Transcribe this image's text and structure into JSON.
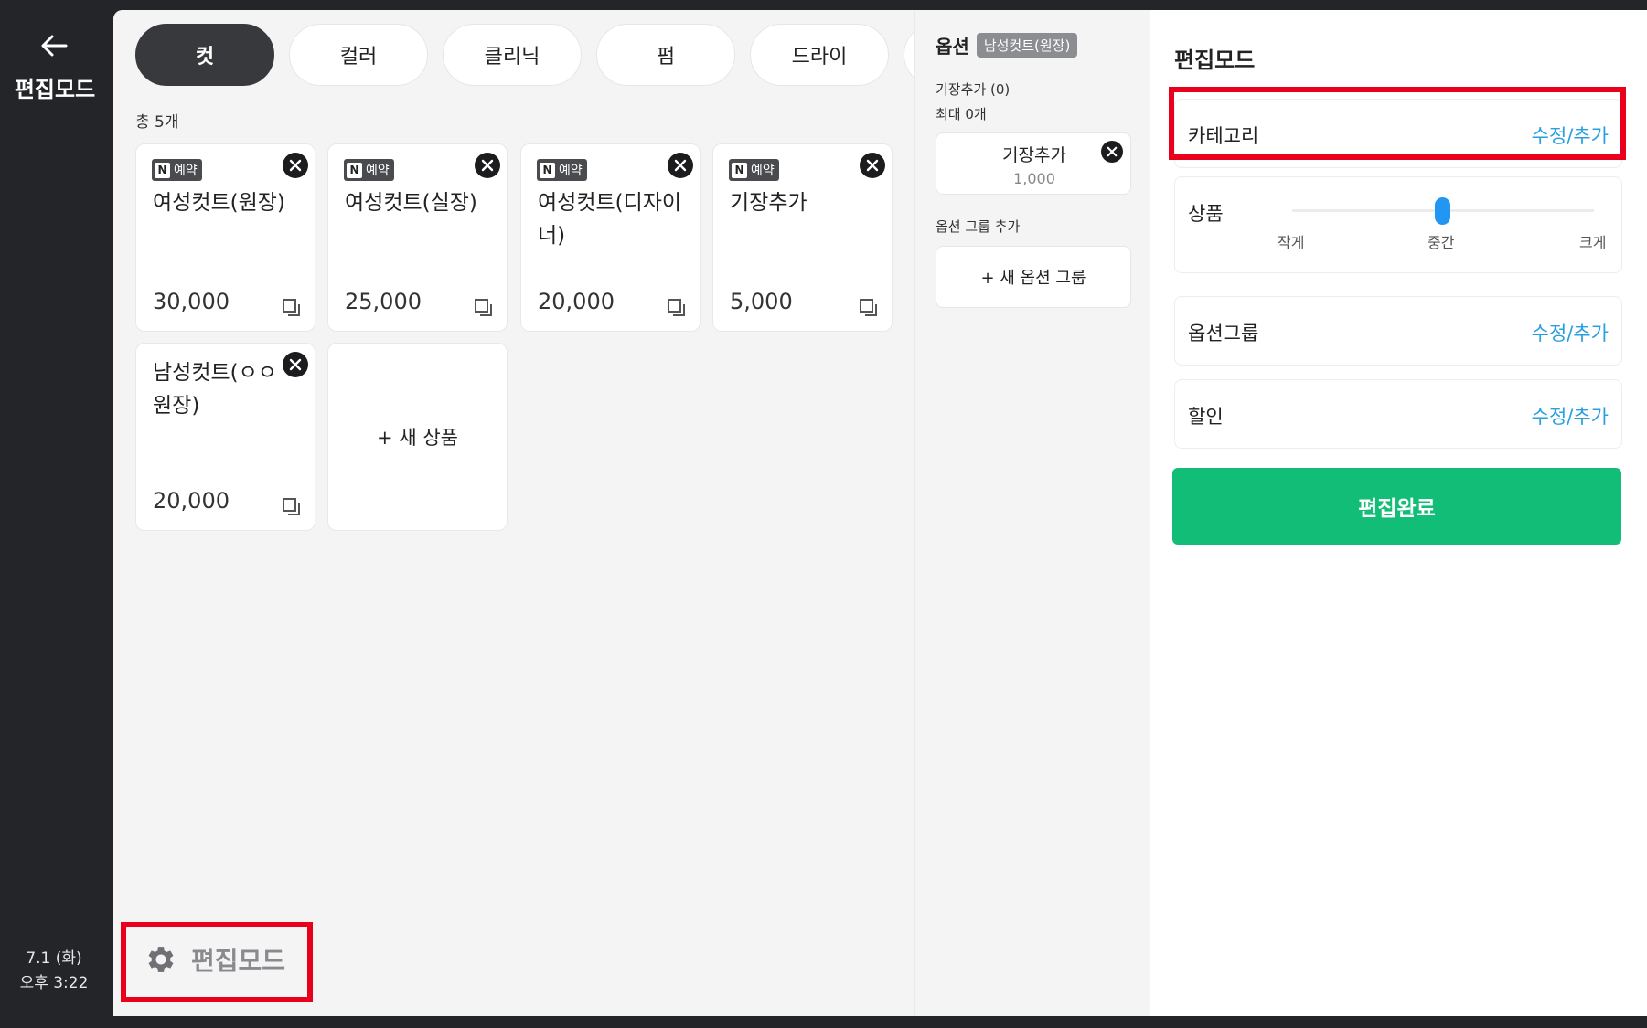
{
  "rail": {
    "title": "편집모드",
    "date": "7.1 (화)",
    "time": "오후 3:22"
  },
  "tabs": [
    {
      "label": "컷",
      "active": true
    },
    {
      "label": "컬러",
      "active": false
    },
    {
      "label": "클리닉",
      "active": false
    },
    {
      "label": "펌",
      "active": false
    },
    {
      "label": "드라이",
      "active": false
    }
  ],
  "product_count": "총 5개",
  "products": [
    {
      "badge": "예약",
      "name": "여성컷트(원장)",
      "price": "30,000"
    },
    {
      "badge": "예약",
      "name": "여성컷트(실장)",
      "price": "25,000"
    },
    {
      "badge": "예약",
      "name": "여성컷트(디자이너)",
      "price": "20,000"
    },
    {
      "badge": "예약",
      "name": "기장추가",
      "price": "5,000"
    },
    {
      "badge": "",
      "name": "남성컷트(ㅇㅇ원장)",
      "price": "20,000"
    }
  ],
  "new_product_label": "+ 새 상품",
  "bottom_edit_label": "편집모드",
  "options": {
    "title": "옵션",
    "selected_product": "남성컷트(원장)",
    "group_line1": "기장추가 (0)",
    "group_line2": "최대 0개",
    "item_name": "기장추가",
    "item_price": "1,000",
    "add_group_label": "옵션 그룹 추가",
    "new_group_label": "+ 새 옵션 그룹"
  },
  "panel": {
    "title": "편집모드",
    "category_label": "카테고리",
    "category_action": "수정/추가",
    "product_size_label": "상품",
    "size_small": "작게",
    "size_medium": "중간",
    "size_large": "크게",
    "size_value": "중간",
    "option_group_label": "옵션그룹",
    "option_group_action": "수정/추가",
    "discount_label": "할인",
    "discount_action": "수정/추가",
    "done_label": "편집완료"
  },
  "colors": {
    "accent_green": "#12be77",
    "link_blue": "#2a9fe0",
    "highlight_red": "#e8001c",
    "slider_blue": "#2196f3"
  }
}
